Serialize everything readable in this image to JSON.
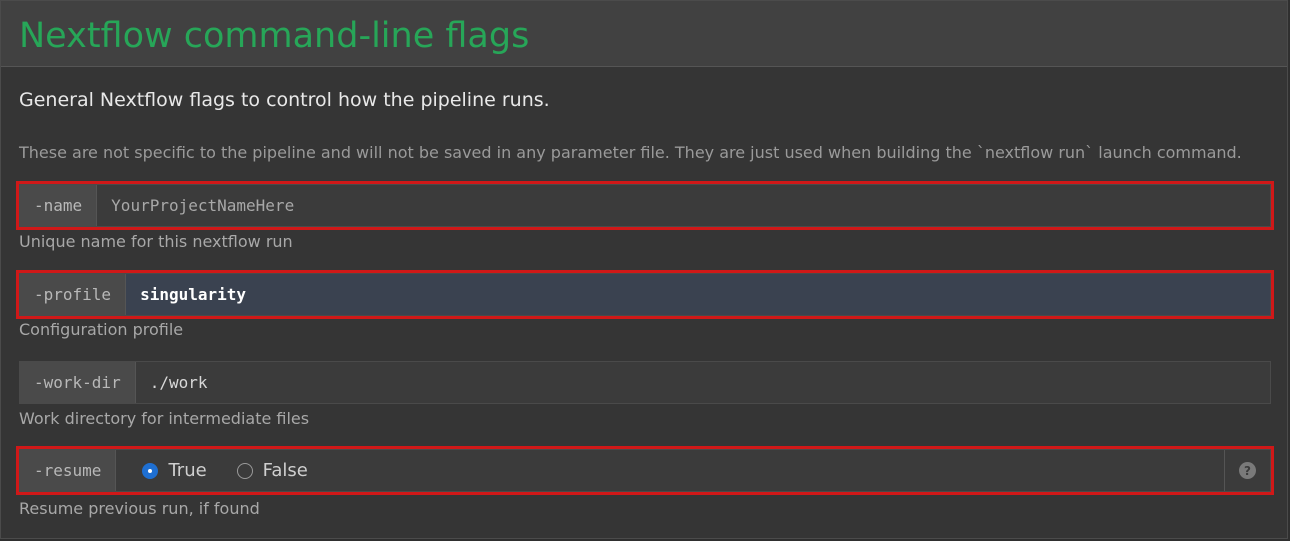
{
  "section": {
    "title": "Nextflow command-line flags",
    "lead": "General Nextflow flags to control how the pipeline runs.",
    "description": "These are not specific to the pipeline and will not be saved in any parameter file. They are just used when building the `nextflow run` launch command."
  },
  "fields": {
    "name": {
      "flag": "-name",
      "placeholder": "YourProjectNameHere",
      "value": "",
      "help": "Unique name for this nextflow run"
    },
    "profile": {
      "flag": "-profile",
      "value": "singularity",
      "help": "Configuration profile"
    },
    "workdir": {
      "flag": "-work-dir",
      "value": "./work",
      "help": "Work directory for intermediate files"
    },
    "resume": {
      "flag": "-resume",
      "option_true": "True",
      "option_false": "False",
      "selected": "True",
      "help": "Resume previous run, if found",
      "help_icon": "?"
    }
  },
  "colors": {
    "title": "#27a658",
    "highlight": "#d01818",
    "radio_checked": "#1f6fd1"
  }
}
